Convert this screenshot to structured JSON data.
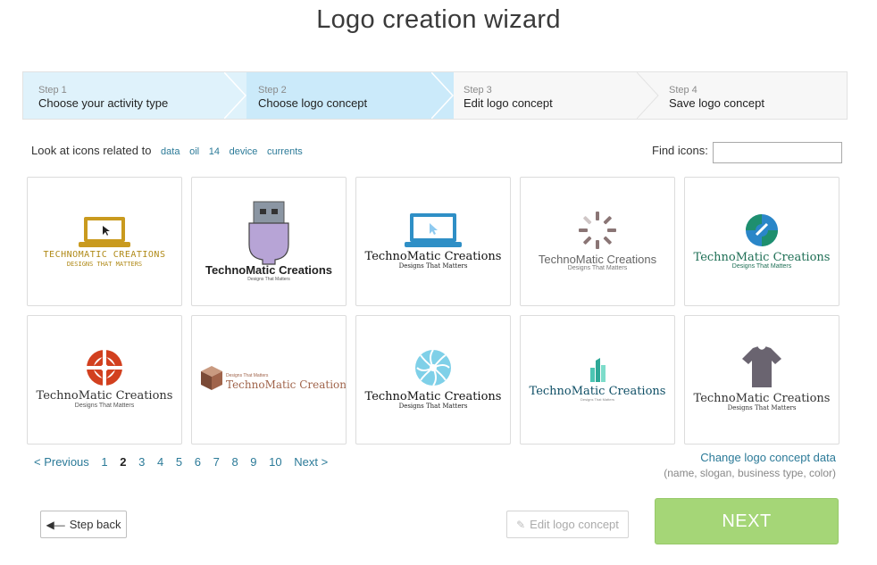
{
  "title": "Logo creation wizard",
  "steps": [
    {
      "num": "Step 1",
      "name": "Choose your activity type"
    },
    {
      "num": "Step 2",
      "name": "Choose logo concept"
    },
    {
      "num": "Step 3",
      "name": "Edit logo concept"
    },
    {
      "num": "Step 4",
      "name": "Save logo concept"
    }
  ],
  "related": {
    "label": "Look at icons related to",
    "tags": [
      "data",
      "oil",
      "14",
      "device",
      "currents"
    ]
  },
  "find": {
    "label": "Find icons:",
    "value": ""
  },
  "logos": [
    {
      "name": "TECHNOMATIC CREATIONS",
      "slogan": "DESIGNS THAT MATTERS",
      "icon": "laptop-cursor-icon",
      "color": "#c99a1e"
    },
    {
      "name": "TechnoMatic Creations",
      "slogan": "Designs That Matters",
      "icon": "usb-plug-icon",
      "color": "#b7a4d6"
    },
    {
      "name": "TechnoMatic Creations",
      "slogan": "Designs That Matters",
      "icon": "laptop-cursor-icon",
      "color": "#2f8fc6"
    },
    {
      "name": "TechnoMatic Creations",
      "slogan": "Designs That Matters",
      "icon": "loading-spinner-icon",
      "color": "#8a7575"
    },
    {
      "name": "TechnoMatic Creations",
      "slogan": "Designs That Matters",
      "icon": "circle-arrows-icon",
      "color": "#1e8f6e"
    },
    {
      "name": "TechnoMatic Creations",
      "slogan": "Designs That Matters",
      "icon": "target-circle-icon",
      "color": "#d2401f"
    },
    {
      "name": "TechnoMatic Creations",
      "slogan": "Designs That Matters",
      "icon": "cube-icon",
      "color": "#a0644b"
    },
    {
      "name": "TechnoMatic Creations",
      "slogan": "Designs That Matters",
      "icon": "swirl-circle-icon",
      "color": "#7fd0e8"
    },
    {
      "name": "TechnoMatic Creations",
      "slogan": "Designs That Matters",
      "icon": "city-towers-icon",
      "color": "#4cc5b3"
    },
    {
      "name": "TechnoMatic Creations",
      "slogan": "Designs That Matters",
      "icon": "tshirt-icon",
      "color": "#6a6470"
    }
  ],
  "pager": {
    "previous": "< Previous",
    "pages": [
      "1",
      "2",
      "3",
      "4",
      "5",
      "6",
      "7",
      "8",
      "9",
      "10"
    ],
    "current": "2",
    "next": "Next >"
  },
  "change": {
    "link": "Change logo concept data",
    "hint": "(name, slogan, business type, color)"
  },
  "buttons": {
    "back": "Step back",
    "edit": "Edit logo concept",
    "next": "NEXT"
  },
  "colors": {
    "accent": "#2b7a98",
    "next_green": "#a5d677",
    "step_active": "#cbeafa",
    "step_done": "#dff2fb"
  }
}
